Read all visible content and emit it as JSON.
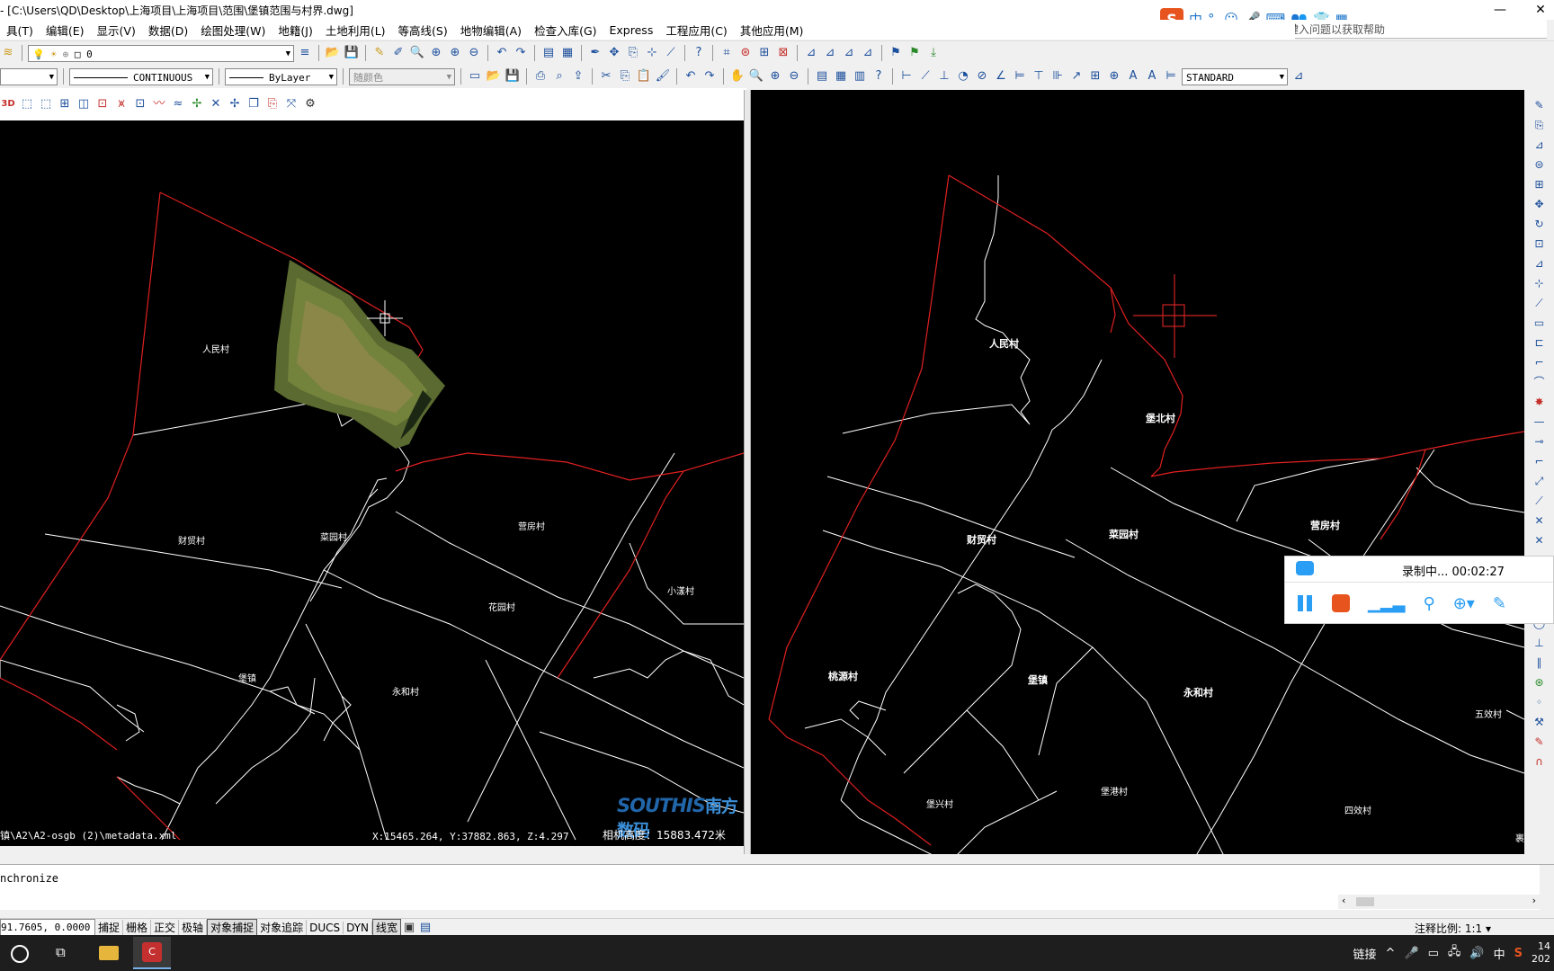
{
  "window": {
    "title": "- [C:\\Users\\QD\\Desktop\\上海项目\\上海项目\\范围\\堡镇范围与村界.dwg]",
    "help_search_placeholder": "键入问题以获取帮助",
    "minimize": "—",
    "close": "✕"
  },
  "ime": {
    "logo": "S",
    "items": [
      "中",
      "°,",
      "☺",
      "🎤",
      "⌨",
      "👥",
      "👕",
      "▦"
    ]
  },
  "menu": [
    "具(T)",
    "编辑(E)",
    "显示(V)",
    "数据(D)",
    "绘图处理(W)",
    "地籍(J)",
    "土地利用(L)",
    "等高线(S)",
    "地物编辑(A)",
    "检查入库(G)",
    "Express",
    "工程应用(C)",
    "其他应用(M)"
  ],
  "toolbar": {
    "layer_value": "0",
    "linetype": "CONTINUOUS",
    "lineweight": "ByLayer",
    "color": "随颜色",
    "text_style": "STANDARD",
    "view3d_label": "3D"
  },
  "left_view": {
    "village_labels": [
      "人民村",
      "财贸村",
      "菜园村",
      "营房村",
      "花园村",
      "小漾村",
      "堡镇",
      "永和村"
    ],
    "path_text": "镇\\A2\\A2-osgb (2)\\metadata.xml",
    "coords_text": "X:15465.264, Y:37882.863, Z:4.297",
    "camera_text": "相机高度：15883.472米",
    "logo_en": "SOUTHIS",
    "logo_cn": "南方数码"
  },
  "right_view": {
    "village_labels": [
      "人民村",
      "堡北村",
      "财贸村",
      "菜园村",
      "营房村",
      "桃源村",
      "堡镇",
      "永和村",
      "五效村",
      "堡兴村",
      "堡港村",
      "四效村",
      "裹"
    ]
  },
  "recorder": {
    "status": "录制中... 00:02:27"
  },
  "command": {
    "line": "nchronize"
  },
  "status": {
    "coords": "91.7605, 0.0000",
    "toggles": [
      "捕捉",
      "栅格",
      "正交",
      "极轴",
      "对象捕捉",
      "对象追踪",
      "DUCS",
      "DYN",
      "线宽"
    ],
    "active_toggles": [
      "对象捕捉",
      "线宽"
    ],
    "annotation_scale_label": "注释比例:",
    "annotation_scale_value": "1:1"
  },
  "taskbar": {
    "app_label": "CASS",
    "tray_link": "链接",
    "tray_ime": "中",
    "time": "14",
    "date": "202"
  },
  "colors": {
    "boundary": "#e02020",
    "village_lines": "#ffffff",
    "cursor": "#cc2222"
  }
}
